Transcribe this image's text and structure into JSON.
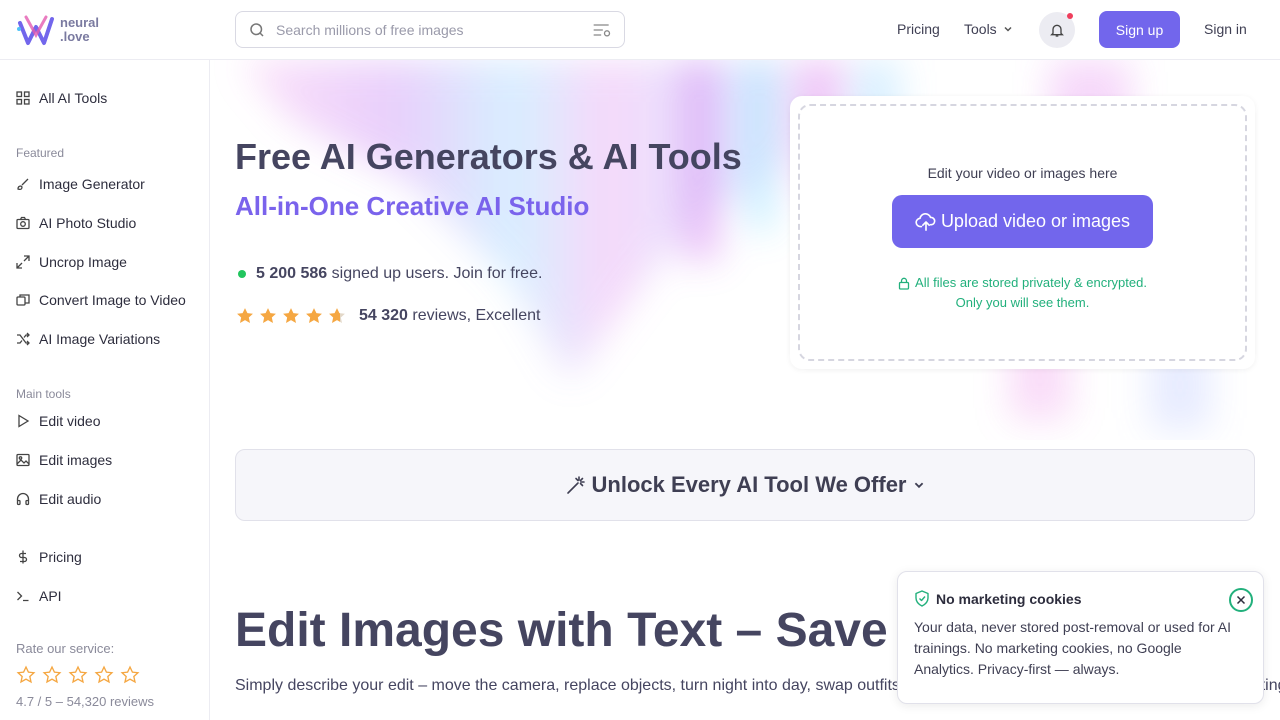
{
  "brand": {
    "line1": "neural",
    "line2": ".love"
  },
  "search": {
    "placeholder": "Search millions of free images"
  },
  "nav": {
    "pricing": "Pricing",
    "tools": "Tools",
    "signup": "Sign up",
    "signin": "Sign in"
  },
  "sidebar": {
    "all_tools": "All AI Tools",
    "featured_heading": "Featured",
    "featured": [
      {
        "label": "Image Generator",
        "icon": "brush-icon"
      },
      {
        "label": "AI Photo Studio",
        "icon": "camera-icon"
      },
      {
        "label": "Uncrop Image",
        "icon": "expand-icon"
      },
      {
        "label": "Convert Image to Video",
        "icon": "images-icon"
      },
      {
        "label": "AI Image Variations",
        "icon": "shuffle-icon"
      }
    ],
    "main_heading": "Main tools",
    "main": [
      {
        "label": "Edit video",
        "icon": "play-icon"
      },
      {
        "label": "Edit images",
        "icon": "image-icon"
      },
      {
        "label": "Edit audio",
        "icon": "headphones-icon"
      }
    ],
    "pricing": "Pricing",
    "api": "API",
    "rate_heading": "Rate our service:",
    "rate_summary": "4.7 / 5 – 54,320 reviews"
  },
  "hero": {
    "title": "Free AI Generators & AI Tools",
    "subtitle": "All-in-One Creative AI Studio",
    "users_count": "5 200 586",
    "users_text": " signed up users. Join for free.",
    "rating": 4.7,
    "reviews_count": "54 320",
    "reviews_text": " reviews, Excellent"
  },
  "upload": {
    "title": "Edit your video or images here",
    "button": "Upload video or images",
    "note_line1": "All files are stored privately & encrypted.",
    "note_line2": "Only you will see them."
  },
  "unlock": {
    "label": "Unlock Every AI Tool We Offer"
  },
  "section": {
    "heading": "Edit Images with Text – Save",
    "desc": "Simply describe your edit – move the camera, replace objects, turn night into day, swap outfits handles it instantly, saving you hours on image editing."
  },
  "cookie": {
    "title": "No marketing cookies",
    "text": "Your data, never stored post-removal or used for AI trainings. No marketing cookies, no Google Analytics. Privacy-first — always."
  },
  "colors": {
    "accent": "#7266ec",
    "green": "#22b07c",
    "star": "#f5a742",
    "notify": "#ef3e5c"
  }
}
